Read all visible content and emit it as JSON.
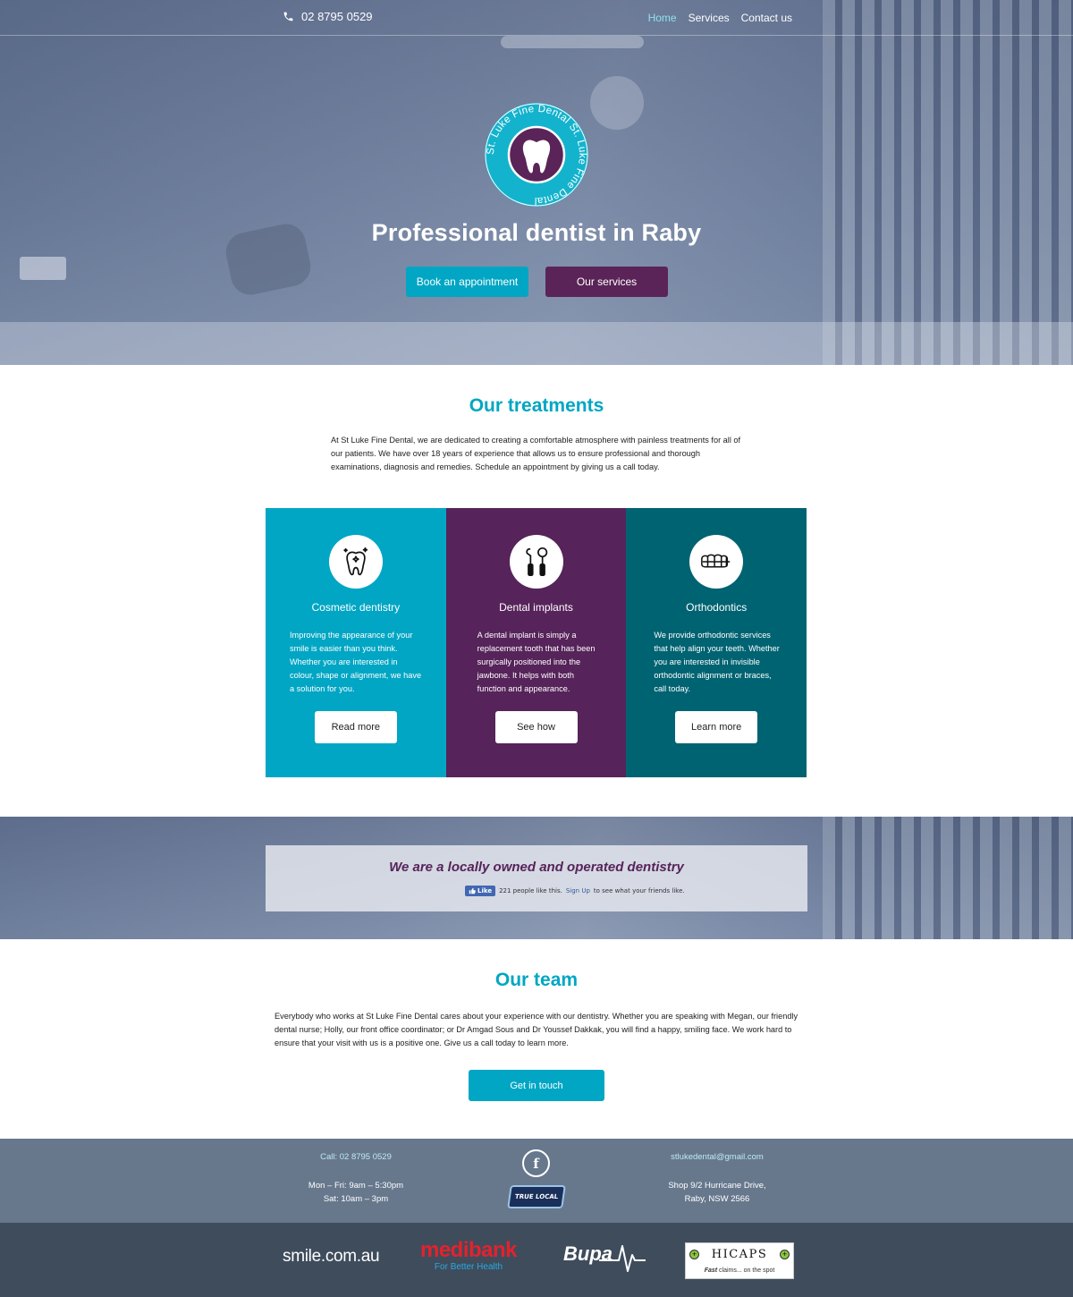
{
  "header": {
    "phone": "02 8795 0529",
    "nav": [
      {
        "label": "Home",
        "active": true
      },
      {
        "label": "Services",
        "active": false
      },
      {
        "label": "Contact us",
        "active": false
      }
    ]
  },
  "logo": {
    "text": "St. Luke Fine Dental St. Luke Fine Dental",
    "icon": "tooth-icon"
  },
  "hero": {
    "title": "Professional dentist in Raby",
    "book_label": "Book an appointment",
    "services_label": "Our services"
  },
  "treatments": {
    "title": "Our treatments",
    "intro": "At St Luke Fine Dental, we are dedicated to creating a comfortable atmosphere with painless treatments for all of our patients. We have over 18 years of experience that allows us to ensure professional and thorough examinations, diagnosis and remedies. Schedule an appointment by giving us a call today.",
    "cards": [
      {
        "title": "Cosmetic dentistry",
        "text": "Improving the appearance of your smile is easier than you think. Whether you are interested in colour, shape or alignment, we have a solution for you.",
        "button": "Read more",
        "icon": "sparkle-tooth-icon",
        "color": "#00a6c4"
      },
      {
        "title": "Dental implants",
        "text": "A dental implant is simply a replacement tooth that has been surgically positioned into the jawbone. It helps with both function and appearance.",
        "button": "See how",
        "icon": "dental-tools-icon",
        "color": "#56235a"
      },
      {
        "title": "Orthodontics",
        "text": "We provide orthodontic services that help align your teeth. Whether you are interested in invisible orthodontic alignment or braces, call today.",
        "button": "Learn more",
        "icon": "braces-icon",
        "color": "#006372"
      }
    ]
  },
  "band": {
    "title": "We are a locally owned and operated dentistry",
    "fb": {
      "like_label": "Like",
      "count_text": "221 people like this.",
      "signup_label": "Sign Up",
      "suffix": "to see what your friends like."
    }
  },
  "team": {
    "title": "Our team",
    "text": "Everybody who works at St Luke Fine Dental cares about your experience with our dentistry. Whether you are speaking with Megan, our friendly dental nurse; Holly, our front office coordinator; or Dr Amgad Sous and Dr Youssef Dakkak, you will find a happy, smiling face. We work hard to ensure that your visit with us is a positive one. Give us a call today to learn more.",
    "button": "Get in touch"
  },
  "footer": {
    "call": "Call: 02 8795 0529",
    "hours_1": "Mon – Fri: 9am – 5:30pm",
    "hours_2": "Sat: 10am – 3pm",
    "email": "stlukedental@gmail.com",
    "address_1": "Shop 9/2 Hurricane Drive,",
    "address_2": "Raby, NSW 2566",
    "facebook_glyph": "f",
    "truelocal_label": "TRUE LOCAL"
  },
  "partners": {
    "smile": "smile.com.au",
    "medibank_1": "medibank",
    "medibank_2": "For Better Health",
    "bupa": "Bupa",
    "hicaps_1": "HICAPS",
    "hicaps_2_em": "Fast",
    "hicaps_2": "claims... on the spot"
  },
  "colors": {
    "accent": "#00a6c4",
    "purple": "#56235a",
    "teal": "#006372",
    "footer": "#67788d",
    "partners_bar": "#3f4c5c"
  }
}
